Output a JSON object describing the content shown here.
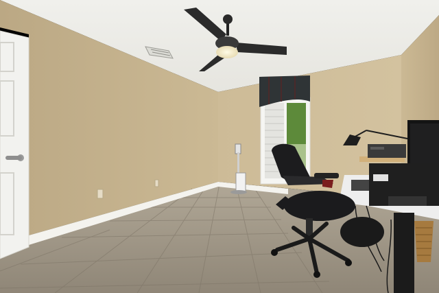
{
  "scene": {
    "kind": "photograph",
    "subject": "home office",
    "colors": {
      "ceiling": "#eeeeea",
      "wall_left": "#c3b08d",
      "wall_back": "#cdbb98",
      "wall_right": "#c8b692",
      "floor": "#a39a8a",
      "baseboard": "#f4f3ee",
      "door": "#f2f2ef",
      "valance": "#2f3436",
      "chair": "#1c1c1e",
      "desk_top": "#eeeeee",
      "greenery": "#5d8a3a"
    }
  }
}
